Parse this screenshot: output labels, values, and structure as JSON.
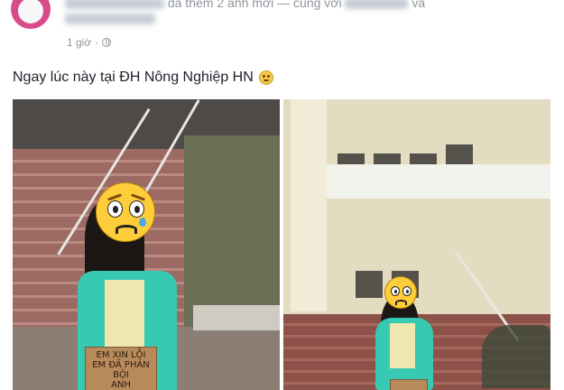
{
  "post": {
    "header_action": "đã thêm 2 ảnh mới",
    "header_with": "— cùng với",
    "header_and": "và",
    "timestamp": "1 giờ",
    "privacy_icon": "globe-icon",
    "text": "Ngay lúc này tại ĐH Nông Nghiệp HN",
    "text_emoji": "sad-face-emoji"
  },
  "photos": [
    {
      "sign_text": "EM XIN LỖI\nEM ĐÃ PHẢN BỘI\nANH"
    },
    {
      "sign_text": ""
    }
  ],
  "colors": {
    "link": "#365899",
    "meta": "#90949c",
    "text": "#1d2129"
  }
}
